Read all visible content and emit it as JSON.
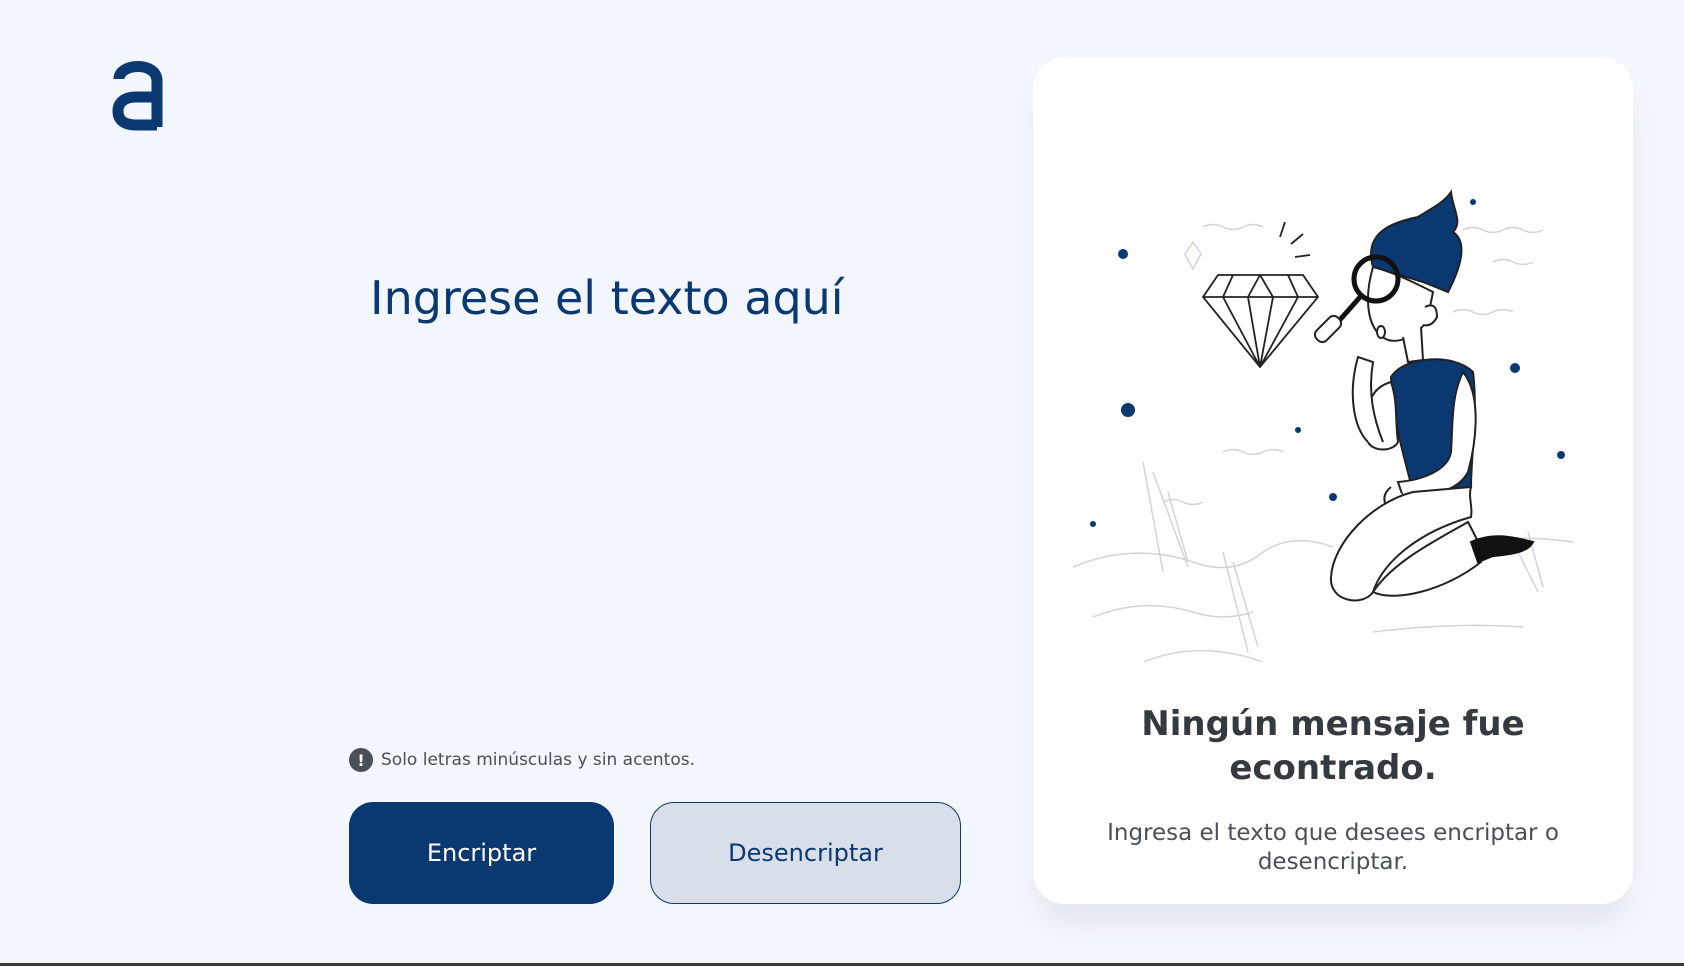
{
  "logo": {
    "icon": "alura-logo-icon",
    "color": "#0a3871"
  },
  "input": {
    "placeholder": "Ingrese el texto aquí",
    "value": ""
  },
  "hint": {
    "icon": "exclamation-icon",
    "text": "Solo letras minúsculas y sin acentos."
  },
  "buttons": {
    "encrypt_label": "Encriptar",
    "decrypt_label": "Desencriptar"
  },
  "output": {
    "illustration": "person-with-magnifying-glass-illustration",
    "title": "Ningún mensaje fue econtrado.",
    "description": "Ingresa el texto que desees encriptar o desencriptar."
  },
  "colors": {
    "background": "#f3f6fc",
    "primary": "#0a3871",
    "secondary_button": "#d8dfe8",
    "card": "#ffffff",
    "text_dark": "#343a40",
    "text_muted": "#495057"
  }
}
